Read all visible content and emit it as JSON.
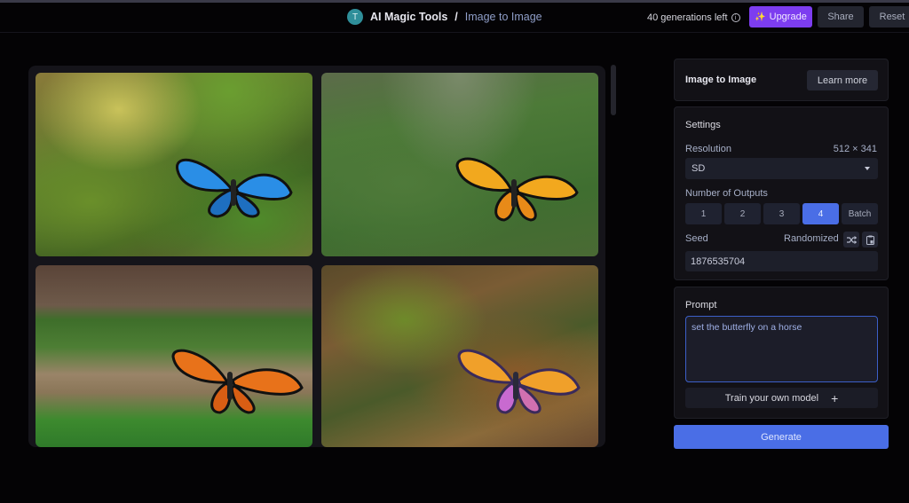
{
  "header": {
    "avatar_letter": "T",
    "brand": "AI Magic Tools",
    "separator": "/",
    "breadcrumb": "Image to Image",
    "generations_left": "40 generations left",
    "info_glyph": "i",
    "upgrade_label": "Upgrade",
    "upgrade_icon": "✨",
    "share_label": "Share",
    "reset_label": "Reset"
  },
  "gallery": {
    "images": [
      {
        "alt": "Blue butterfly on mossy ground with purple flowers"
      },
      {
        "alt": "Orange monarch butterfly over grassy field with dirt paths"
      },
      {
        "alt": "Monarch butterfly over a village with dirt roads"
      },
      {
        "alt": "Colorful butterfly over a miniature town landscape"
      }
    ]
  },
  "side": {
    "title": "Image to Image",
    "learn_more": "Learn more",
    "settings": {
      "title": "Settings",
      "resolution_label": "Resolution",
      "resolution_value": "512 × 341",
      "resolution_selected": "SD",
      "outputs_label": "Number of Outputs",
      "outputs_options": [
        "1",
        "2",
        "3",
        "4",
        "Batch"
      ],
      "outputs_selected": "4",
      "seed_label": "Seed",
      "seed_mode": "Randomized",
      "seed_value": "1876535704"
    },
    "prompt": {
      "title": "Prompt",
      "value": "set the butterfly on a horse",
      "train_label": "Train your own model",
      "train_icon": "+"
    },
    "generate_label": "Generate"
  },
  "colors": {
    "accent": "#4a6ee6",
    "upgrade": "#7d3df0",
    "background": "#040305",
    "panel": "#121116"
  }
}
